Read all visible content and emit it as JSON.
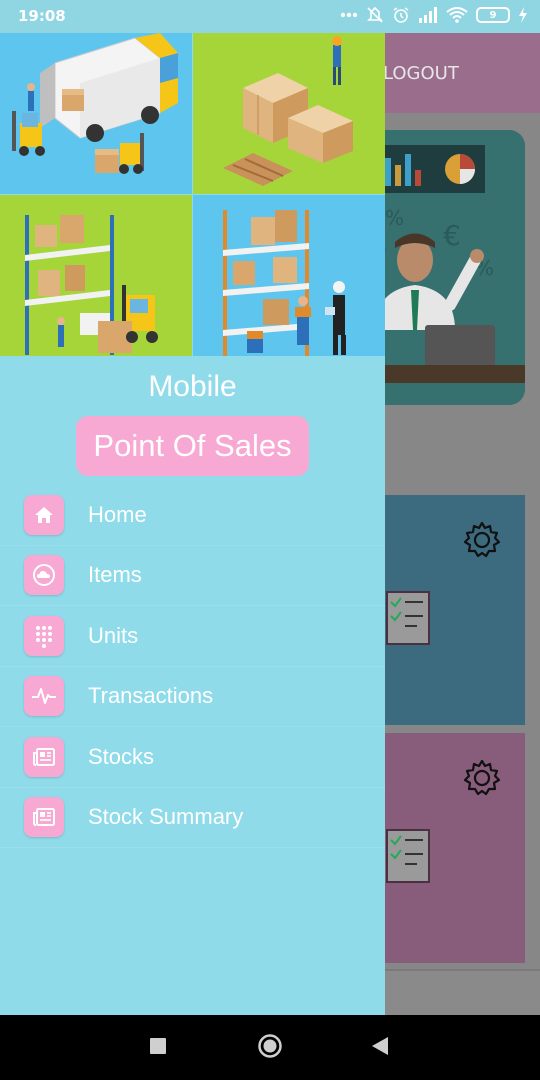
{
  "status_bar": {
    "time": "19:08",
    "battery_level": "9",
    "icons": [
      "more-dots-icon",
      "alarm-off-icon",
      "alarm-clock-icon",
      "signal-icon",
      "wifi-icon",
      "battery-icon",
      "charging-icon"
    ]
  },
  "background_app": {
    "logout_label": "LOGOUT"
  },
  "drawer": {
    "brand_line1": "Mobile",
    "brand_line2": "Point Of Sales",
    "menu": [
      {
        "label": "Home",
        "icon": "home-icon"
      },
      {
        "label": "Items",
        "icon": "cloud-icon"
      },
      {
        "label": "Units",
        "icon": "dialpad-icon"
      },
      {
        "label": "Transactions",
        "icon": "pulse-icon"
      },
      {
        "label": "Stocks",
        "icon": "newspaper-icon"
      },
      {
        "label": "Stock Summary",
        "icon": "newspaper-icon"
      }
    ]
  },
  "colors": {
    "drawer_bg": "#8fdbea",
    "accent_pink": "#f7a8d3",
    "tile_blue": "#5ec6ee",
    "tile_green": "#a6d53a"
  },
  "nav_bar": {
    "buttons": [
      "recents-button",
      "home-button",
      "back-button"
    ]
  }
}
